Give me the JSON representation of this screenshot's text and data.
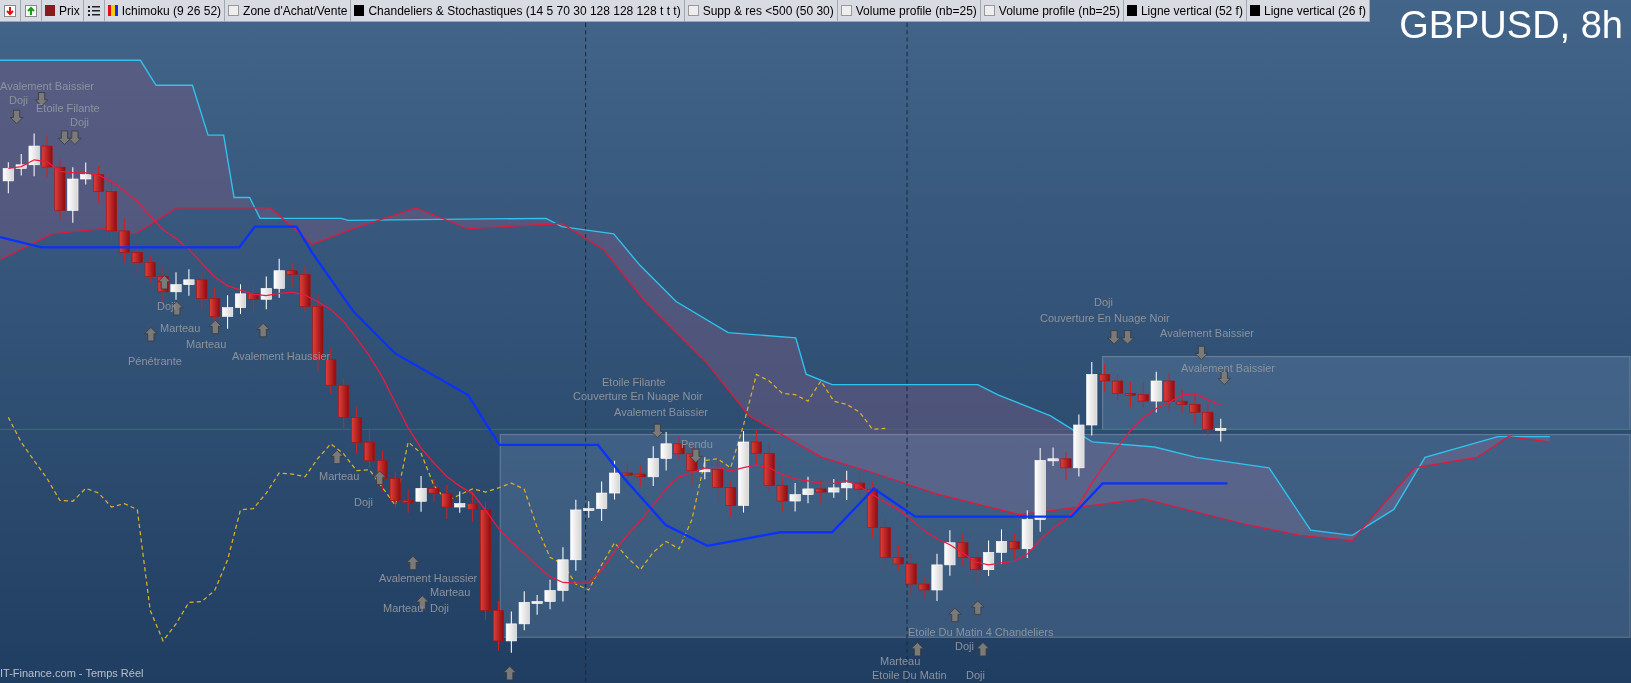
{
  "toolbar": {
    "legend": [
      {
        "label": "Prix",
        "kind": "filled",
        "color": "#8b1a1a"
      },
      {
        "label": "Ichimoku (9 26 52)",
        "kind": "multicolor"
      },
      {
        "label": "Zone d'Achat/Vente",
        "kind": "empty"
      },
      {
        "label": "Chandeliers & Stochastiques (14 5 70 30 128 128 128 t t t)",
        "kind": "filled",
        "color": "#000000"
      },
      {
        "label": "Supp & res <500 (50 30)",
        "kind": "empty"
      },
      {
        "label": "Volume profile (nb=25)",
        "kind": "empty"
      },
      {
        "label": "Volume profile (nb=25)",
        "kind": "empty"
      },
      {
        "label": "Ligne vertical (52 f)",
        "kind": "filled",
        "color": "#000000"
      },
      {
        "label": "Ligne vertical (26 f)",
        "kind": "filled",
        "color": "#000000"
      }
    ]
  },
  "chart": {
    "title": "GBPUSD, 8h",
    "pattern_labels": [
      {
        "text": "Avalement Baissier"
      },
      {
        "text": "Doji"
      },
      {
        "text": "Etoile Filante"
      },
      {
        "text": "Doji"
      },
      {
        "text": "Doji"
      },
      {
        "text": "Marteau"
      },
      {
        "text": "Pénétrante"
      },
      {
        "text": "Marteau"
      },
      {
        "text": "Avalement Haussier"
      },
      {
        "text": "Marteau"
      },
      {
        "text": "Doji"
      },
      {
        "text": "Etoile Filante"
      },
      {
        "text": "Couverture En Nuage Noir"
      },
      {
        "text": "Avalement Baissier"
      },
      {
        "text": "Pendu"
      },
      {
        "text": "Avalement Haussier"
      },
      {
        "text": "Marteau"
      },
      {
        "text": "Marteau"
      },
      {
        "text": "Doji"
      },
      {
        "text": "Doji"
      },
      {
        "text": "Couverture En Nuage Noir"
      },
      {
        "text": "Avalement Baissier"
      },
      {
        "text": "Avalement Baissier"
      },
      {
        "text": "Etoile Du Matin 4 Chandeliers"
      },
      {
        "text": "Doji"
      },
      {
        "text": "Marteau"
      },
      {
        "text": "Etoile Du Matin"
      },
      {
        "text": "Doji"
      }
    ],
    "footer": "IT-Finance.com - Temps Réel"
  }
}
